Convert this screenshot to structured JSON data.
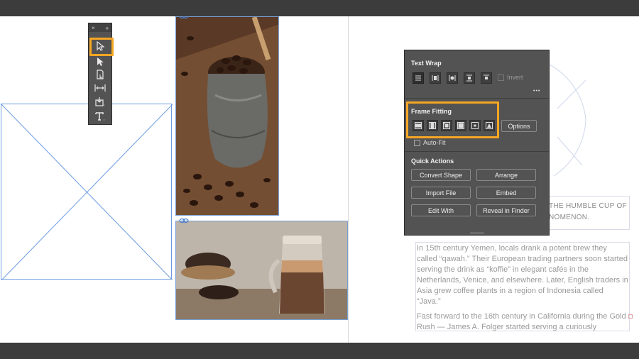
{
  "tools_panel": {
    "close_glyph": "×",
    "collapse_glyph": "»",
    "tools": [
      {
        "name": "selection-tool-icon"
      },
      {
        "name": "direct-selection-tool-icon"
      },
      {
        "name": "page-tool-icon"
      },
      {
        "name": "gap-tool-icon"
      },
      {
        "name": "content-collector-icon"
      },
      {
        "name": "type-tool-icon"
      }
    ]
  },
  "properties_panel": {
    "text_wrap": {
      "title": "Text Wrap",
      "invert_label": "Invert",
      "more_glyph": "•••"
    },
    "frame_fitting": {
      "title": "Frame Fitting",
      "options_label": "Options",
      "auto_fit_label": "Auto-Fit"
    },
    "quick_actions": {
      "title": "Quick Actions",
      "buttons": [
        "Convert Shape",
        "Arrange",
        "Import File",
        "Embed",
        "Edit With",
        "Reveal in Finder"
      ]
    }
  },
  "page_text": {
    "heading": "THE HUMBLE CUP OF NOMENON.",
    "paragraphs": [
      "In 15th century Yemen, locals drank a potent brew they called “qawah.” Their European trading partners soon started serving the drink as “koffie” in elegant cafés in the Netherlands, Venice, and elsewhere. Later, English traders in Asia grew coffee plants in a region of Indonesia called “Java.”",
      "Fast forward to the 16th century in California during the Gold Rush — James A. Folger started serving a curiously"
    ]
  },
  "colors": {
    "highlight": "#f5a623",
    "frame_edge": "#6b9be0",
    "panel_bg": "#535353"
  }
}
